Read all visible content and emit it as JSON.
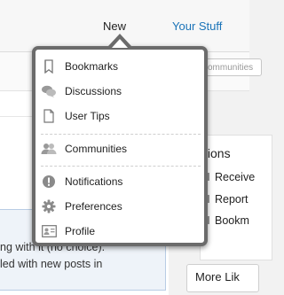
{
  "nav": {
    "new_label": "New",
    "your_stuff_label": "Your Stuff"
  },
  "background": {
    "search_placeholder": "ommunities",
    "text_lines": [
      "ng with it (no choice).",
      "led with new posts in"
    ],
    "right_title": "tions",
    "right_items": [
      "Receive",
      "Report",
      "Bookm"
    ],
    "more_label": "More Lik"
  },
  "menu": {
    "group1": [
      {
        "label": "Bookmarks",
        "icon": "bookmark-icon"
      },
      {
        "label": "Discussions",
        "icon": "discussions-icon"
      },
      {
        "label": "User Tips",
        "icon": "document-icon"
      }
    ],
    "group2": [
      {
        "label": "Communities",
        "icon": "communities-icon"
      }
    ],
    "group3": [
      {
        "label": "Notifications",
        "icon": "notification-icon"
      },
      {
        "label": "Preferences",
        "icon": "gear-icon"
      },
      {
        "label": "Profile",
        "icon": "profile-card-icon"
      }
    ]
  },
  "colors": {
    "accent": "#1a73b8",
    "menu_border": "#6b6b6b"
  }
}
